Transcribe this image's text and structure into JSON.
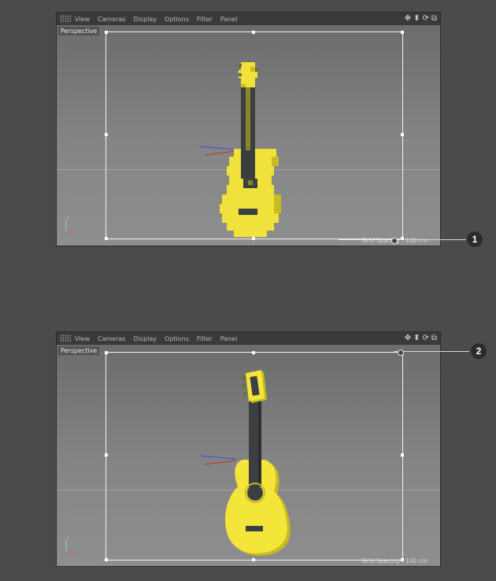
{
  "menu": {
    "items": [
      "View",
      "Cameras",
      "Display",
      "Options",
      "Filter",
      "Panel"
    ]
  },
  "nav_icons": [
    "move-icon",
    "zoom-icon",
    "rotate-icon",
    "maximize-view-icon"
  ],
  "viewport1": {
    "camera_label": "Perspective",
    "grid_spacing": "Grid Spacing : 100 cm"
  },
  "viewport2": {
    "camera_label": "Perspective",
    "grid_spacing": "Grid Spacing : 100 cm"
  },
  "callouts": [
    "1",
    "2"
  ],
  "colors": {
    "guitar_yellow": "#f0e23a",
    "guitar_dark": "#3c3f42",
    "background": "#4b4b4b",
    "viewport_bg": "#7a7a7a"
  }
}
